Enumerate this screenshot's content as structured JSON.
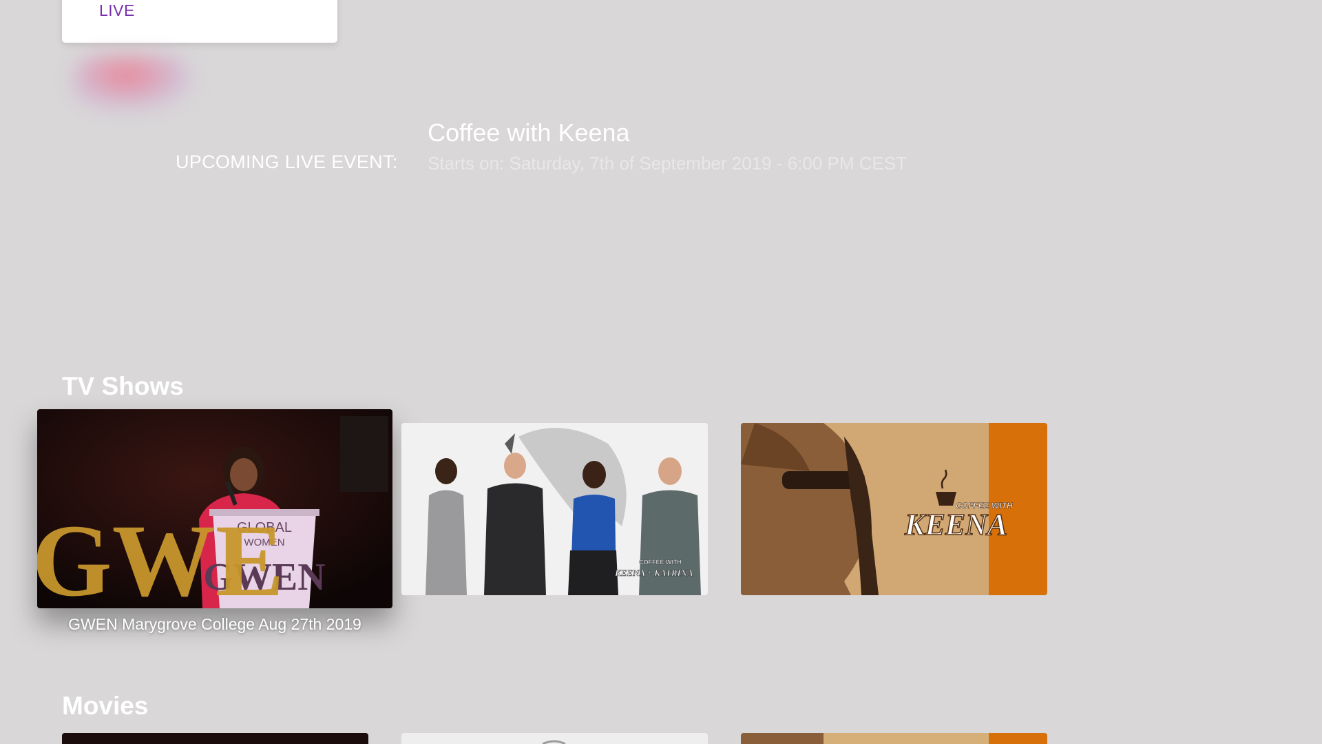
{
  "top_card": {
    "label": "LIVE"
  },
  "upcoming": {
    "label": "UPCOMING LIVE EVENT:",
    "title": "Coffee with Keena",
    "starts_on": "Starts on: Saturday, 7th of September 2019 - 6:00 PM CEST"
  },
  "tv_shows": {
    "title": "TV Shows",
    "items": [
      {
        "caption": "GWEN Marygrove College Aug 27th 2019",
        "focused": true,
        "podium_text": [
          "GLOBAL",
          "WOMEN",
          "GWEN"
        ],
        "balloon_text": "GWE"
      },
      {
        "caption": "",
        "focused": false,
        "overlay_top": "COFFEE WITH",
        "overlay_bottom": "KEENA + KATRINA"
      },
      {
        "caption": "",
        "focused": false,
        "brand_small": "COFFEE WITH",
        "brand_big": "KEENA"
      }
    ]
  },
  "movies": {
    "title": "Movies"
  },
  "colors": {
    "background": "#d9d7d8",
    "live_accent": "#7a2fb0",
    "orange": "#d8700a"
  }
}
